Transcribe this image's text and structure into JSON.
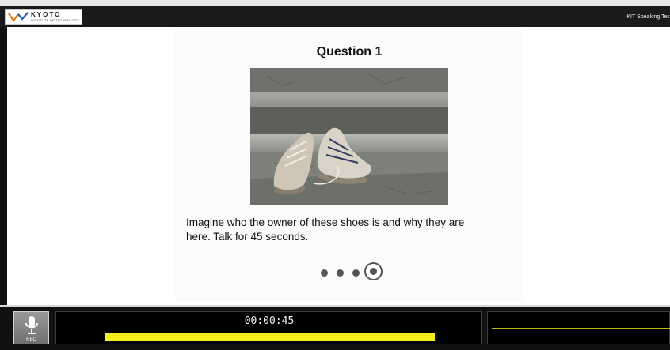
{
  "header": {
    "logo_text": "KYOTO",
    "logo_subtext": "INSTITUTE OF TECHNOLOGY",
    "app_title": "KIT Speaking Tes"
  },
  "question": {
    "title": "Question 1",
    "image_description_icon": "photo-of-worn-sneakers-on-stone-steps",
    "prompt_line1": "Imagine who the owner of these shoes is and why they are",
    "prompt_line2": "here. Talk for 45 seconds."
  },
  "pagination": {
    "total_steps": 4,
    "current_step": 4
  },
  "recorder": {
    "rec_label": "REC",
    "icon": "microphone-icon",
    "timer": "00:00:45",
    "progress_fraction": 0.99,
    "progress_color": "#f2ef1a"
  },
  "colors": {
    "frame": "#111111",
    "content_bg": "#ffffff",
    "accent_yellow": "#f2ef1a"
  }
}
